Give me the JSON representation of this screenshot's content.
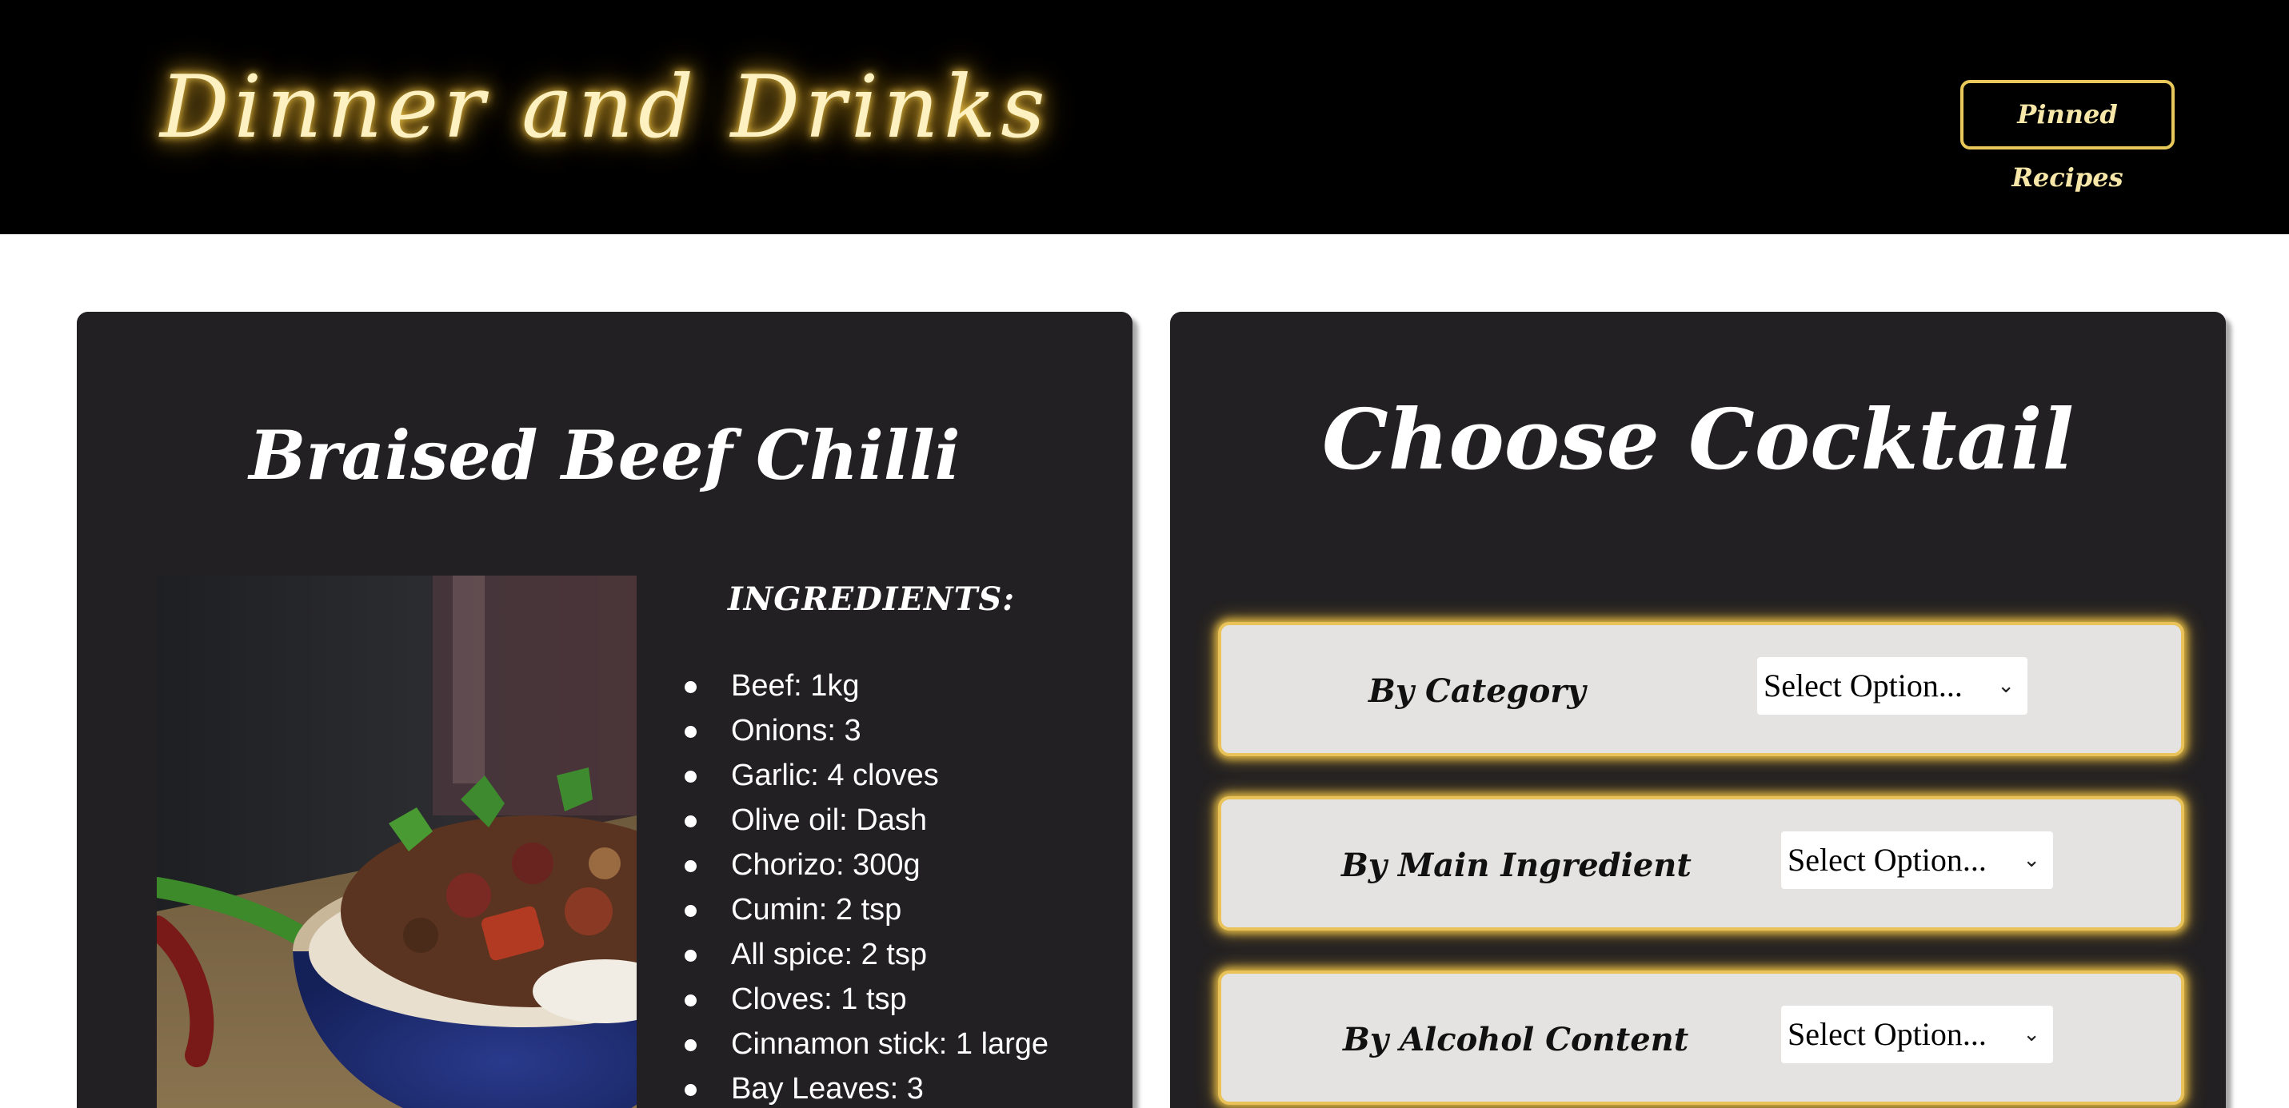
{
  "header": {
    "logo_text": "Dinner and Drinks",
    "pinned_button_label": "Pinned Recipes"
  },
  "recipe": {
    "title": "Braised Beef Chilli",
    "ingredients_heading": "INGREDIENTS:",
    "ingredients": [
      "Beef: 1kg",
      "Onions: 3",
      "Garlic: 4 cloves",
      "Olive oil: Dash",
      "Chorizo: 300g",
      "Cumin: 2 tsp",
      "All spice: 2 tsp",
      "Cloves: 1 tsp",
      "Cinnamon stick: 1 large",
      "Bay Leaves: 3"
    ]
  },
  "cocktail": {
    "title": "Choose Cocktail",
    "filters": [
      {
        "label": "By Category",
        "select_value": "Select Option..."
      },
      {
        "label": "By Main Ingredient",
        "select_value": "Select Option..."
      },
      {
        "label": "By Alcohol Content",
        "select_value": "Select Option..."
      }
    ]
  },
  "colors": {
    "header_bg": "#000000",
    "card_bg": "#222022",
    "accent_gold": "#e9c25a",
    "filter_bg": "#e4e3e1"
  }
}
